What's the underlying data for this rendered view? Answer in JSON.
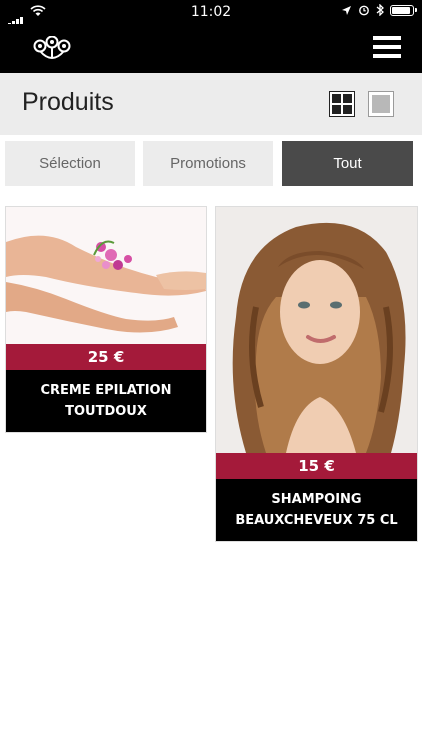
{
  "status_bar": {
    "time": "11:02"
  },
  "header": {
    "logo_icon": "peacock-logo-icon",
    "menu_icon": "hamburger-menu-icon"
  },
  "page": {
    "title": "Produits"
  },
  "tabs": [
    {
      "label": "Sélection"
    },
    {
      "label": "Promotions"
    },
    {
      "label": "Tout",
      "active": true
    }
  ],
  "products": [
    {
      "price": "25 €",
      "name": "CREME EPILATION TOUTDOUX",
      "image": "legs-with-flowers"
    },
    {
      "price": "15 €",
      "name": "SHAMPOING BEAUXCHEVEUX 75 CL",
      "image": "woman-curly-hair"
    }
  ],
  "colors": {
    "price_bar": "#a41a3a",
    "active_tab": "#4a4a4a",
    "header": "#000000"
  }
}
